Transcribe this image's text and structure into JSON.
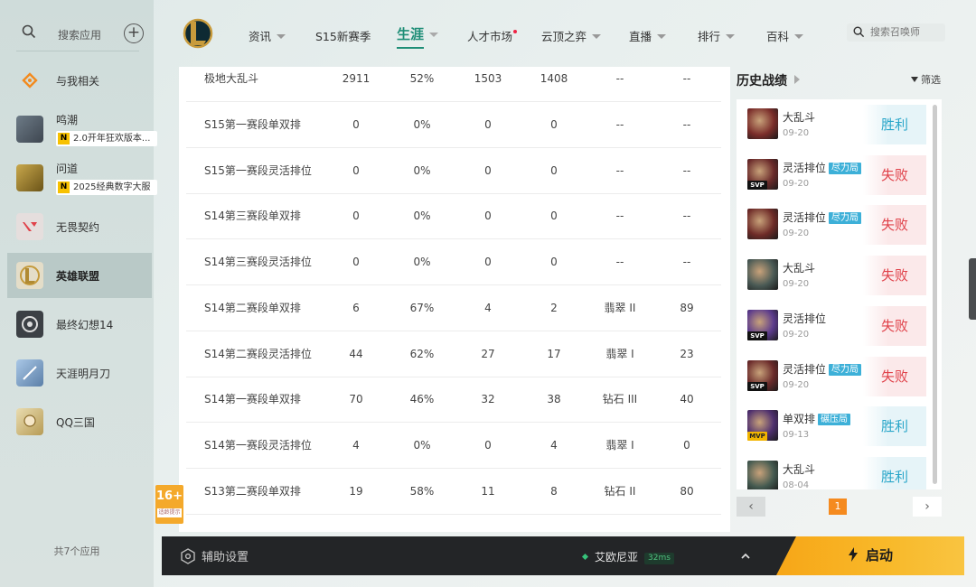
{
  "sidebar": {
    "search_label": "搜索应用",
    "items": [
      {
        "name": "与我相关"
      },
      {
        "name": "鸣潮",
        "sub": "2.0开年狂欢版本..."
      },
      {
        "name": "问道",
        "sub": "2025经典数字大服"
      },
      {
        "name": "无畏契约"
      },
      {
        "name": "英雄联盟",
        "active": true
      },
      {
        "name": "最终幻想14"
      },
      {
        "name": "天涯明月刀"
      },
      {
        "name": "QQ三国"
      }
    ],
    "footer": "共7个应用"
  },
  "nav": {
    "items": [
      "资讯",
      "S15新赛季",
      "生涯",
      "人才市场",
      "云顶之弈",
      "直播",
      "排行",
      "百科"
    ],
    "active": "生涯",
    "search_placeholder": "搜索召唤师"
  },
  "stats": {
    "rows": [
      [
        "极地大乱斗",
        "2911",
        "52%",
        "1503",
        "1408",
        "--",
        "--"
      ],
      [
        "S15第一赛段单双排",
        "0",
        "0%",
        "0",
        "0",
        "--",
        "--"
      ],
      [
        "S15第一赛段灵活排位",
        "0",
        "0%",
        "0",
        "0",
        "--",
        "--"
      ],
      [
        "S14第三赛段单双排",
        "0",
        "0%",
        "0",
        "0",
        "--",
        "--"
      ],
      [
        "S14第三赛段灵活排位",
        "0",
        "0%",
        "0",
        "0",
        "--",
        "--"
      ],
      [
        "S14第二赛段单双排",
        "6",
        "67%",
        "4",
        "2",
        "翡翠 II",
        "89"
      ],
      [
        "S14第二赛段灵活排位",
        "44",
        "62%",
        "27",
        "17",
        "翡翠 I",
        "23"
      ],
      [
        "S14第一赛段单双排",
        "70",
        "46%",
        "32",
        "38",
        "钻石 III",
        "40"
      ],
      [
        "S14第一赛段灵活排位",
        "4",
        "0%",
        "0",
        "4",
        "翡翠 I",
        "0"
      ],
      [
        "S13第二赛段单双排",
        "19",
        "58%",
        "11",
        "8",
        "钻石 II",
        "80"
      ]
    ]
  },
  "age_badge": {
    "big": "16+",
    "small": "适龄提示"
  },
  "history": {
    "title": "历史战绩",
    "filter_label": "筛选",
    "matches": [
      {
        "mode": "大乱斗",
        "tag": "",
        "badge": "",
        "date": "09-20",
        "result": "胜利",
        "win": true,
        "champ_color": "#7a2d2a"
      },
      {
        "mode": "灵活排位",
        "tag": "尽力局",
        "badge": "SVP",
        "date": "09-20",
        "result": "失败",
        "win": false,
        "champ_color": "#6a2a2a"
      },
      {
        "mode": "灵活排位",
        "tag": "尽力局",
        "badge": "",
        "date": "09-20",
        "result": "失败",
        "win": false,
        "champ_color": "#6e2b28"
      },
      {
        "mode": "大乱斗",
        "tag": "",
        "badge": "",
        "date": "09-20",
        "result": "失败",
        "win": false,
        "champ_color": "#4a5a55"
      },
      {
        "mode": "灵活排位",
        "tag": "",
        "badge": "SVP",
        "date": "09-20",
        "result": "失败",
        "win": false,
        "champ_color": "#5b3a8c"
      },
      {
        "mode": "灵活排位",
        "tag": "尽力局",
        "badge": "SVP",
        "date": "09-20",
        "result": "失败",
        "win": false,
        "champ_color": "#6a2a2a"
      },
      {
        "mode": "单双排",
        "tag": "碾压局",
        "badge": "MVP",
        "date": "09-13",
        "result": "胜利",
        "win": true,
        "champ_color": "#4e2f6e"
      },
      {
        "mode": "大乱斗",
        "tag": "",
        "badge": "",
        "date": "08-04",
        "result": "胜利",
        "win": true,
        "champ_color": "#445a50"
      }
    ],
    "pager": {
      "prev": "‹",
      "page": "1",
      "next": "›"
    }
  },
  "bottom": {
    "assist_label": "辅助设置",
    "server": "艾欧尼亚",
    "ping": "32ms",
    "launch_label": "启动"
  },
  "colors": {
    "accent": "#1f8e77",
    "win": "#2aa6c9",
    "lose": "#e0424a",
    "launch": "#f7a617",
    "page_active": "#f58a1f"
  }
}
